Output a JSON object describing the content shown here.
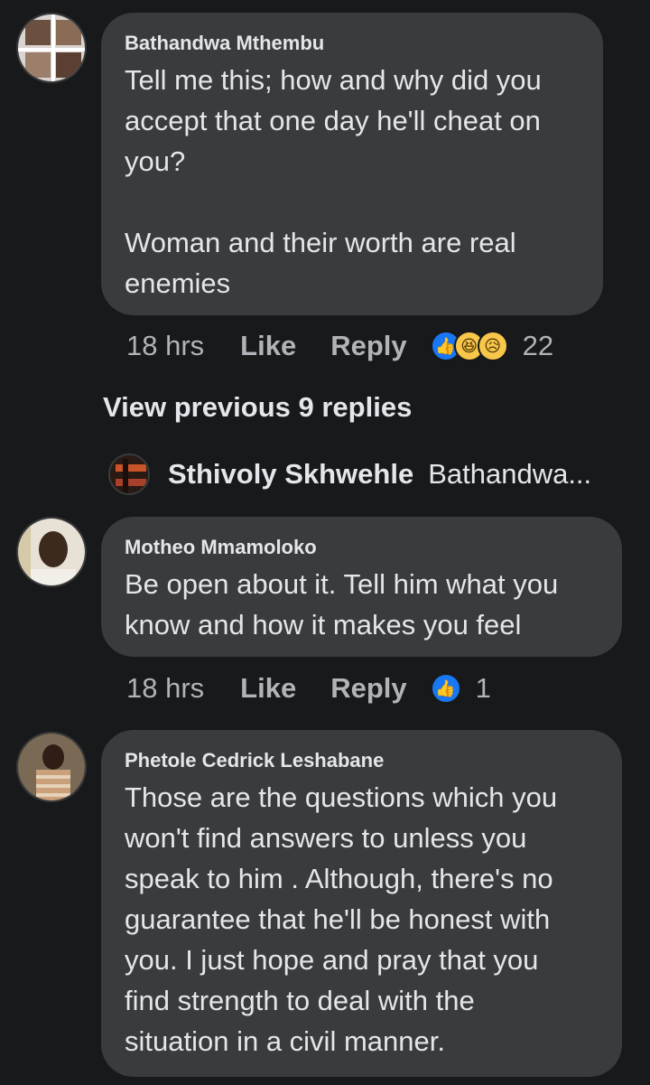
{
  "comments": [
    {
      "author": "Bathandwa Mthembu",
      "text": "Tell me this; how and why did you\naccept that one day he'll cheat on\nyou?\n\nWoman and their worth are real\nenemies",
      "time": "18 hrs",
      "like_label": "Like",
      "reply_label": "Reply",
      "reactions": [
        "like-icon",
        "haha-icon",
        "sad-icon"
      ],
      "reaction_count": "22"
    },
    {
      "author": "Motheo Mmamoloko",
      "text": "Be open about it. Tell him what you\nknow and how it makes you feel",
      "time": "18 hrs",
      "like_label": "Like",
      "reply_label": "Reply",
      "reactions": [
        "like-icon"
      ],
      "reaction_count": "1"
    },
    {
      "author": "Phetole Cedrick Leshabane",
      "text": "Those are the questions which you\nwon't find answers to unless you\nspeak to him . Although, there's no\nguarantee that he'll be honest with\nyou. I just hope and pray that you\nfind strength to deal with the\nsituation in a civil manner."
    }
  ],
  "thread": {
    "view_previous": "View previous 9 replies",
    "reply_preview_name": "Sthivoly Skhwehle",
    "reply_preview_text": "Bathandwa..."
  },
  "colors": {
    "background": "#18191a",
    "bubble": "#3a3b3c",
    "like_blue": "#1877f2",
    "muted_text": "#b0b3b8"
  }
}
